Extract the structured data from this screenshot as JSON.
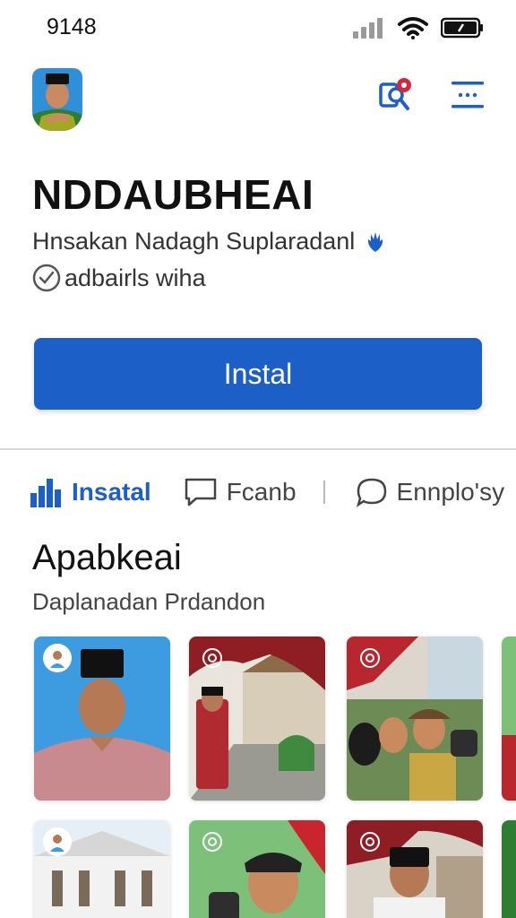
{
  "status_bar": {
    "time": "9148",
    "icons": [
      "signal-icon",
      "wifi-icon",
      "battery-icon"
    ]
  },
  "header": {
    "avatar": "avatar",
    "actions": [
      "search-pin-icon",
      "menu-icon"
    ]
  },
  "app": {
    "title": "NDDAUBHEAI",
    "subtitle": "Hnsakan Nadagh Suplaradanl",
    "verified_label": "adbairls wiha"
  },
  "install_button": {
    "label": "Instal"
  },
  "tabs": [
    {
      "label": "Insatal",
      "icon": "chart-icon",
      "active": true
    },
    {
      "label": "Fcanb",
      "icon": "chat-square-icon",
      "active": false
    },
    {
      "label": "Ennplo'sy",
      "icon": "chat-round-icon",
      "active": false
    }
  ],
  "section": {
    "title": "Apabkeai",
    "subtitle": "Daplanadan Prdandon"
  },
  "colors": {
    "accent": "#1c5fc7",
    "notification": "#d8253a",
    "card_red": "#b8262e",
    "card_blue": "#3d9be0",
    "card_green": "#7cc07a"
  }
}
